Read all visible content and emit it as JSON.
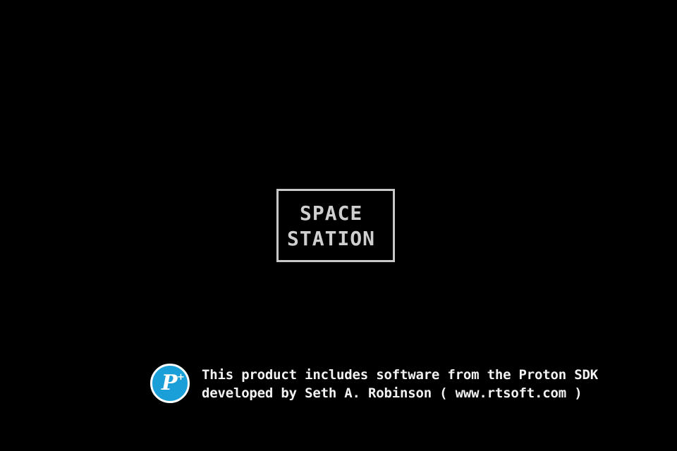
{
  "game": {
    "logo": {
      "line1": "SPACE",
      "line2": "STATION",
      "text_color": "#cfcfcf",
      "border_color": "#c8c8c8"
    },
    "credits": {
      "badge_letter": "P",
      "badge_plus": "+",
      "badge_color": "#1a9fd8",
      "line1": "This product includes software from the Proton SDK",
      "line2": "developed by Seth A. Robinson ( www.rtsoft.com )"
    },
    "background_color": "#000000"
  }
}
